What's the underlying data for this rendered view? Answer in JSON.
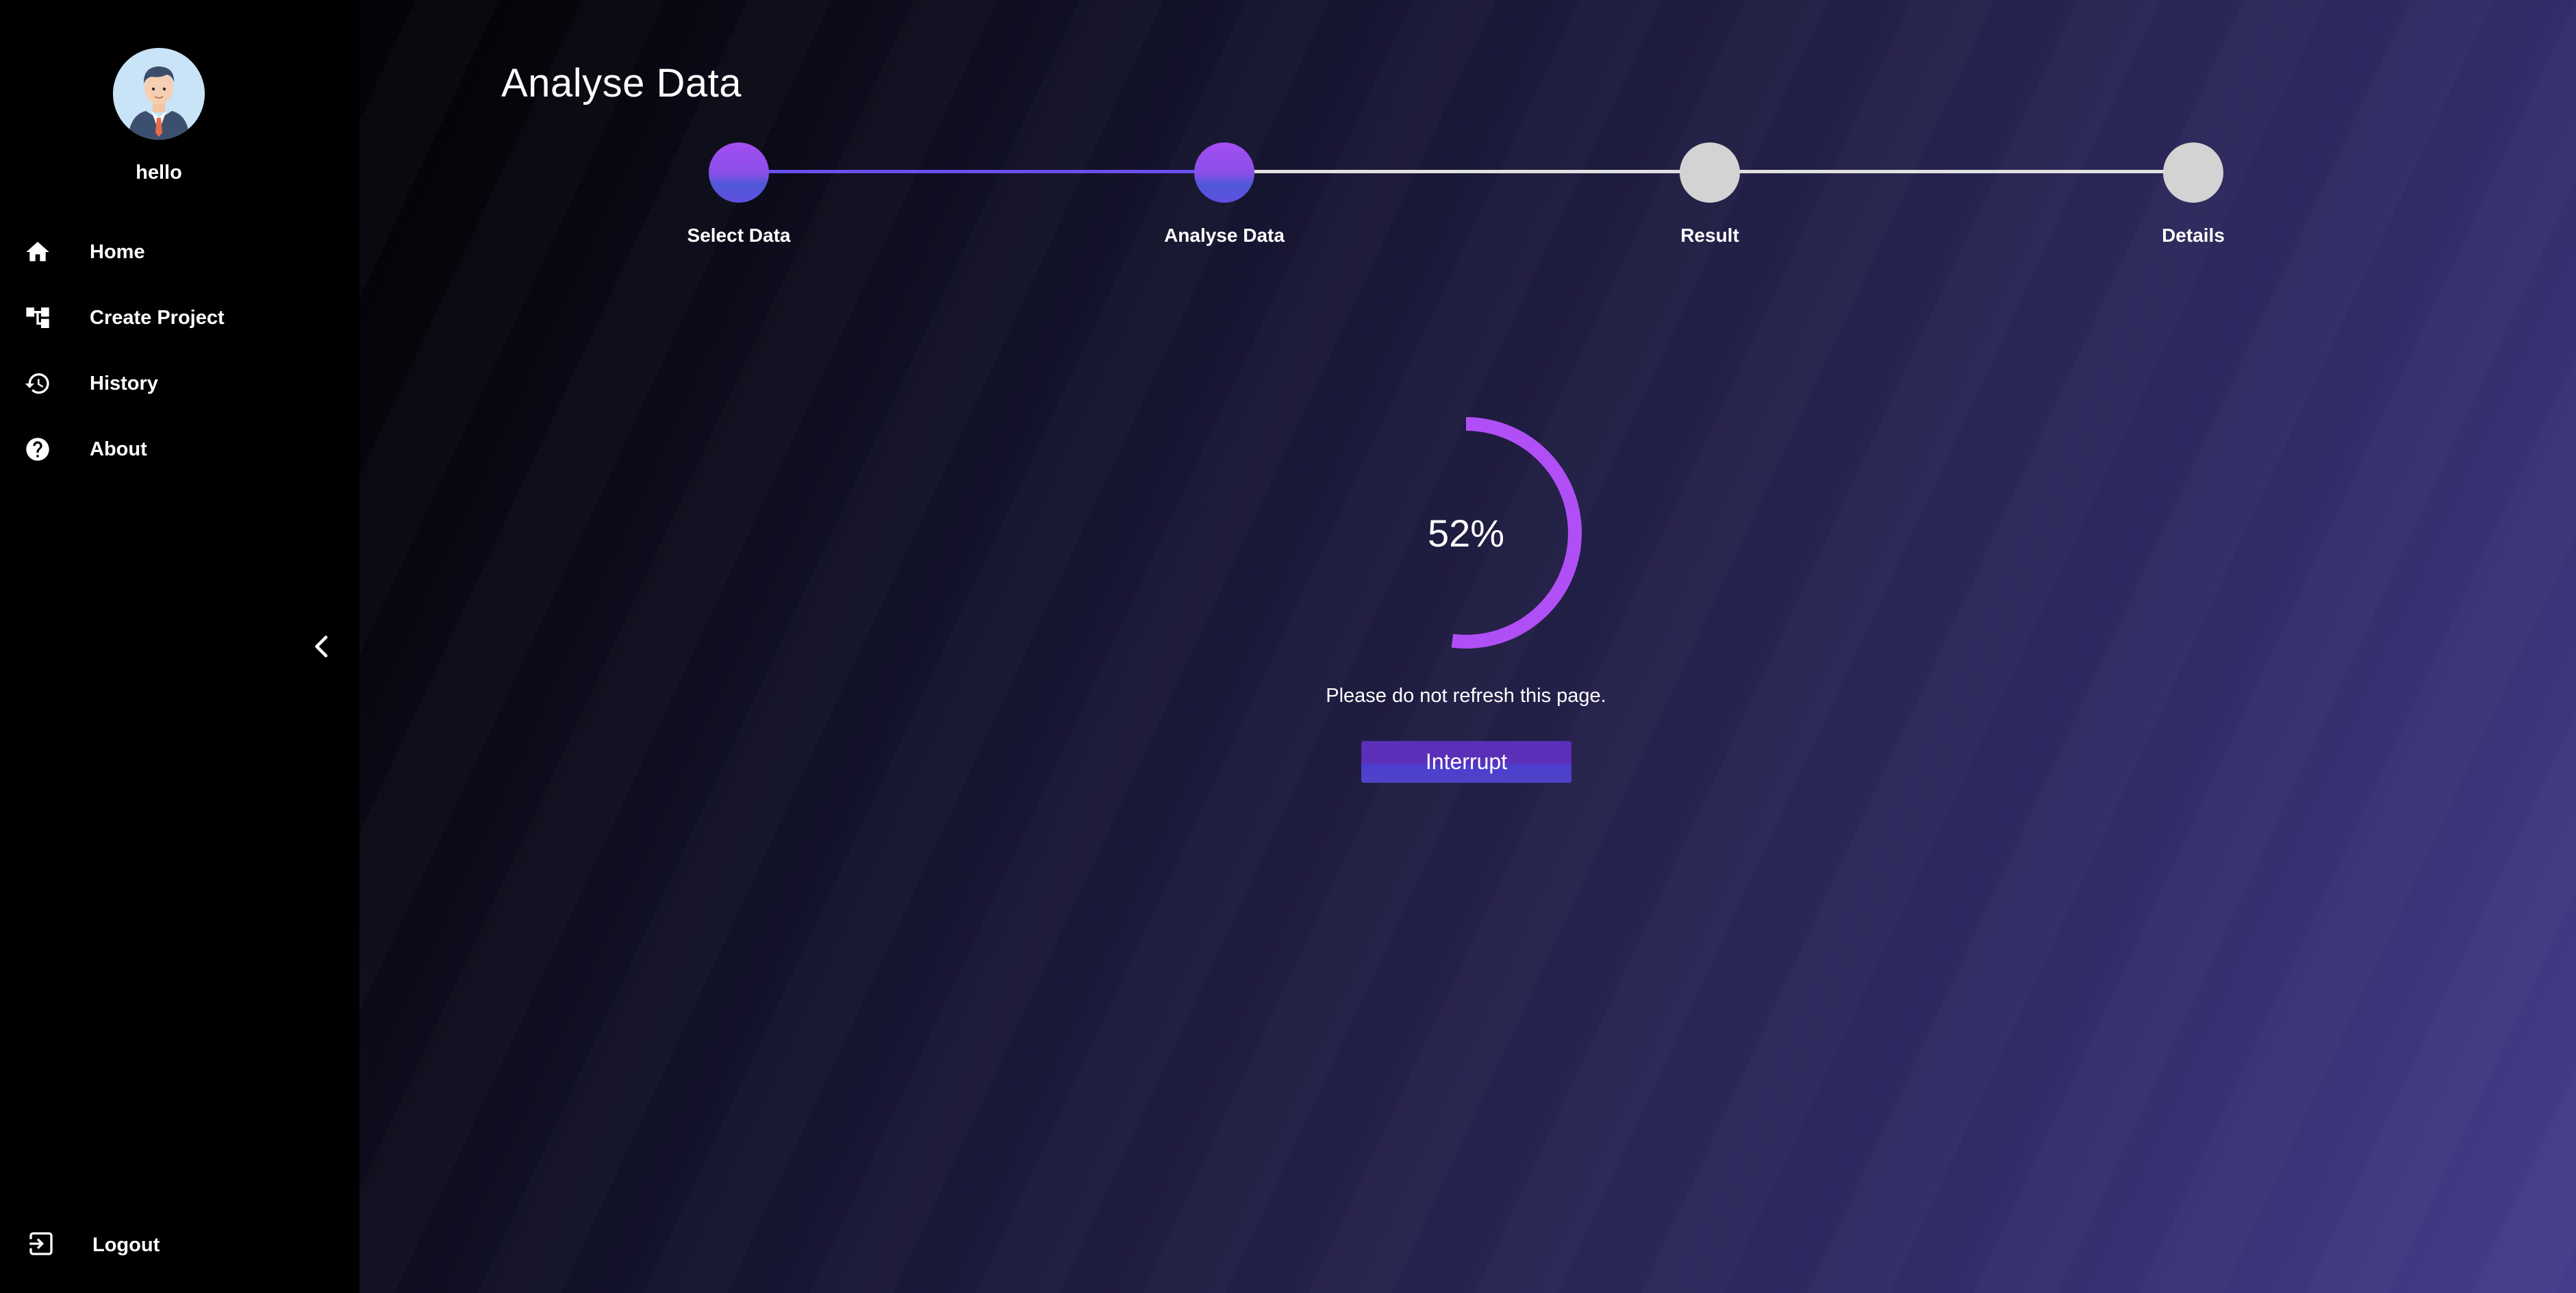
{
  "sidebar": {
    "username": "hello",
    "nav": [
      {
        "label": "Home",
        "icon": "home-icon"
      },
      {
        "label": "Create Project",
        "icon": "project-tree-icon"
      },
      {
        "label": "History",
        "icon": "history-icon"
      },
      {
        "label": "About",
        "icon": "help-circle-icon"
      }
    ],
    "collapse_icon": "chevron-left-icon",
    "logout_label": "Logout",
    "logout_icon": "logout-icon"
  },
  "main": {
    "title": "Analyse Data",
    "steps": [
      {
        "label": "Select Data",
        "status": "done"
      },
      {
        "label": "Analyse Data",
        "status": "active"
      },
      {
        "label": "Result",
        "status": "pending"
      },
      {
        "label": "Details",
        "status": "pending"
      }
    ],
    "progress": {
      "value": 52,
      "text": "52%"
    },
    "notice": "Please do not refresh this page.",
    "interrupt_label": "Interrupt"
  },
  "colors": {
    "accent": "#b14ff7",
    "step_done": "#8b4fe8",
    "step_pending": "#d3d3d3",
    "step_line_done": "#6a4ff0",
    "step_line_pending": "#e0e0e0",
    "sidebar_bg": "#000000"
  }
}
